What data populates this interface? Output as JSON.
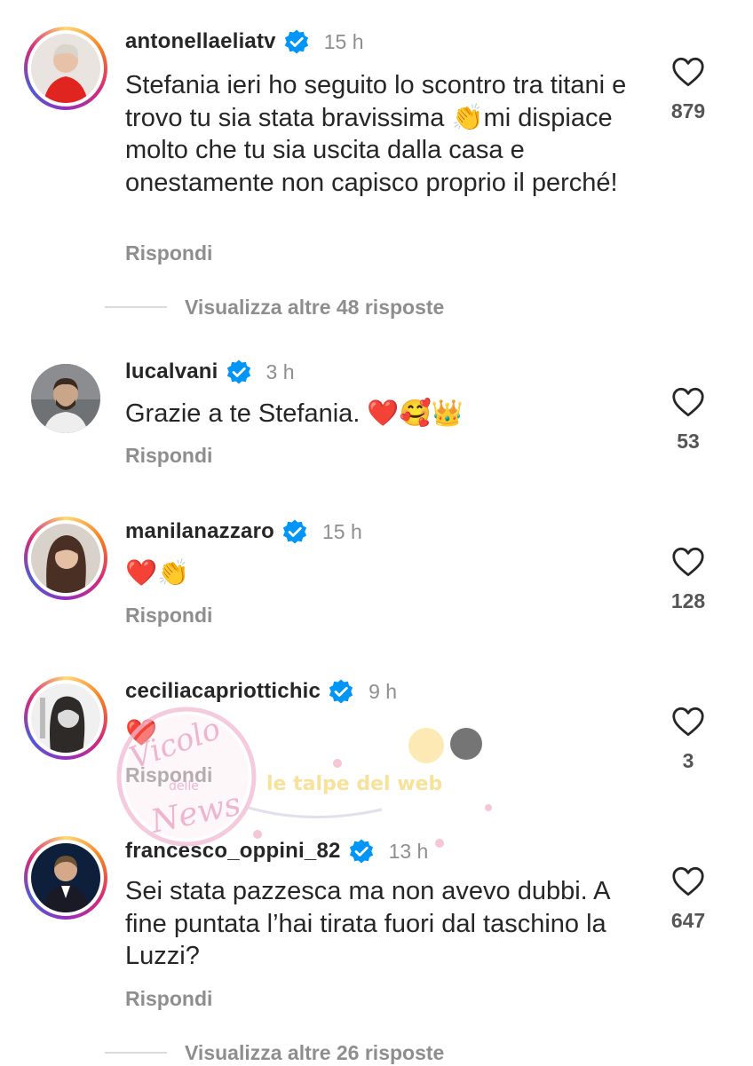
{
  "comments": [
    {
      "username": "antonellaeliatv",
      "time": "15 h",
      "text": "Stefania ieri ho seguito lo scontro tra titani e trovo tu sia stata bravissima 👏mi dispiace molto che tu sia uscita dalla casa e onestamente non capisco proprio il perché!",
      "reply_label": "Rispondi",
      "likes": "879",
      "verified": true,
      "has_story_ring": true
    },
    {
      "username": "lucalvani",
      "time": "3 h",
      "text": "Grazie a te Stefania. ❤️🥰👑",
      "reply_label": "Rispondi",
      "likes": "53",
      "verified": true,
      "has_story_ring": false
    },
    {
      "username": "manilanazzaro",
      "time": "15 h",
      "text": "❤️👏",
      "reply_label": "Rispondi",
      "likes": "128",
      "verified": true,
      "has_story_ring": true
    },
    {
      "username": "ceciliacapriottichic",
      "time": "9 h",
      "text": "❤️",
      "reply_label": "Rispondi",
      "likes": "3",
      "verified": true,
      "has_story_ring": true
    },
    {
      "username": "francesco_oppini_82",
      "time": "13 h",
      "text": "Sei stata pazzesca ma non avevo dubbi. A fine puntata l’hai tirata fuori dal taschino la Luzzi?",
      "reply_label": "Rispondi",
      "likes": "647",
      "verified": true,
      "has_story_ring": true
    }
  ],
  "view_more_1": "Visualizza altre 48 risposte",
  "view_more_2": "Visualizza altre 26 risposte",
  "watermark": {
    "line1": "Vicolo",
    "line2": "delle",
    "line3": "News",
    "banner": "le talpe del web"
  },
  "icons": {
    "verified": "verified-badge-icon",
    "like": "heart-outline-icon"
  },
  "colors": {
    "verified_blue": "#0095f6",
    "secondary_text": "#8e8e8e",
    "primary_text": "#262626"
  }
}
